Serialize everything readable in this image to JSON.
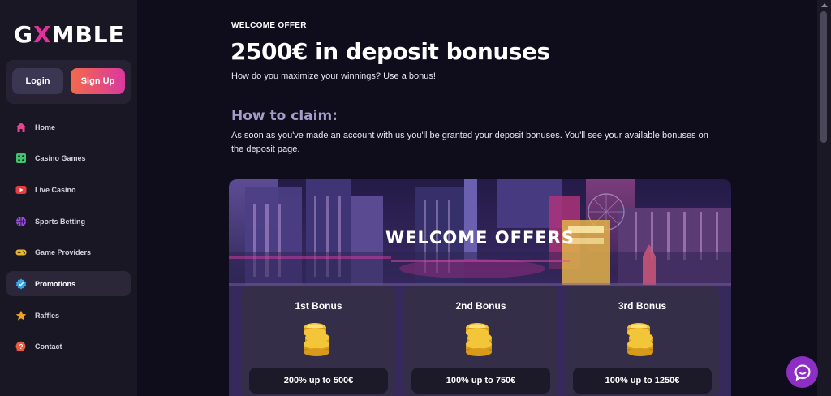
{
  "brand": {
    "logo_prefix": "G",
    "logo_x": "X",
    "logo_suffix": "MBLE",
    "accent": "#e0329a"
  },
  "auth": {
    "login_label": "Login",
    "signup_label": "Sign Up"
  },
  "nav": [
    {
      "label": "Home",
      "icon": "home-icon"
    },
    {
      "label": "Casino Games",
      "icon": "dice-icon"
    },
    {
      "label": "Live Casino",
      "icon": "play-icon"
    },
    {
      "label": "Sports Betting",
      "icon": "ball-icon"
    },
    {
      "label": "Game Providers",
      "icon": "gamepad-icon"
    },
    {
      "label": "Promotions",
      "icon": "badge-icon",
      "active": true
    },
    {
      "label": "Raffles",
      "icon": "star-icon"
    },
    {
      "label": "Contact",
      "icon": "help-icon"
    }
  ],
  "page": {
    "eyebrow": "WELCOME OFFER",
    "title": "2500€ in deposit bonuses",
    "subtitle": "How do you maximize your winnings? Use a bonus!",
    "how_title": "How to claim:",
    "how_text": "As soon as you've made an account with us you'll be granted your deposit bonuses. You'll see your available bonuses on the deposit page."
  },
  "offers": {
    "title": "WELCOME OFFERS",
    "cards": [
      {
        "title": "1st Bonus",
        "value": "200% up to 500€"
      },
      {
        "title": "2nd Bonus",
        "value": "100% up to 750€"
      },
      {
        "title": "3rd Bonus",
        "value": "100% up to 1250€"
      }
    ]
  },
  "chat": {
    "icon": "chat-icon"
  }
}
